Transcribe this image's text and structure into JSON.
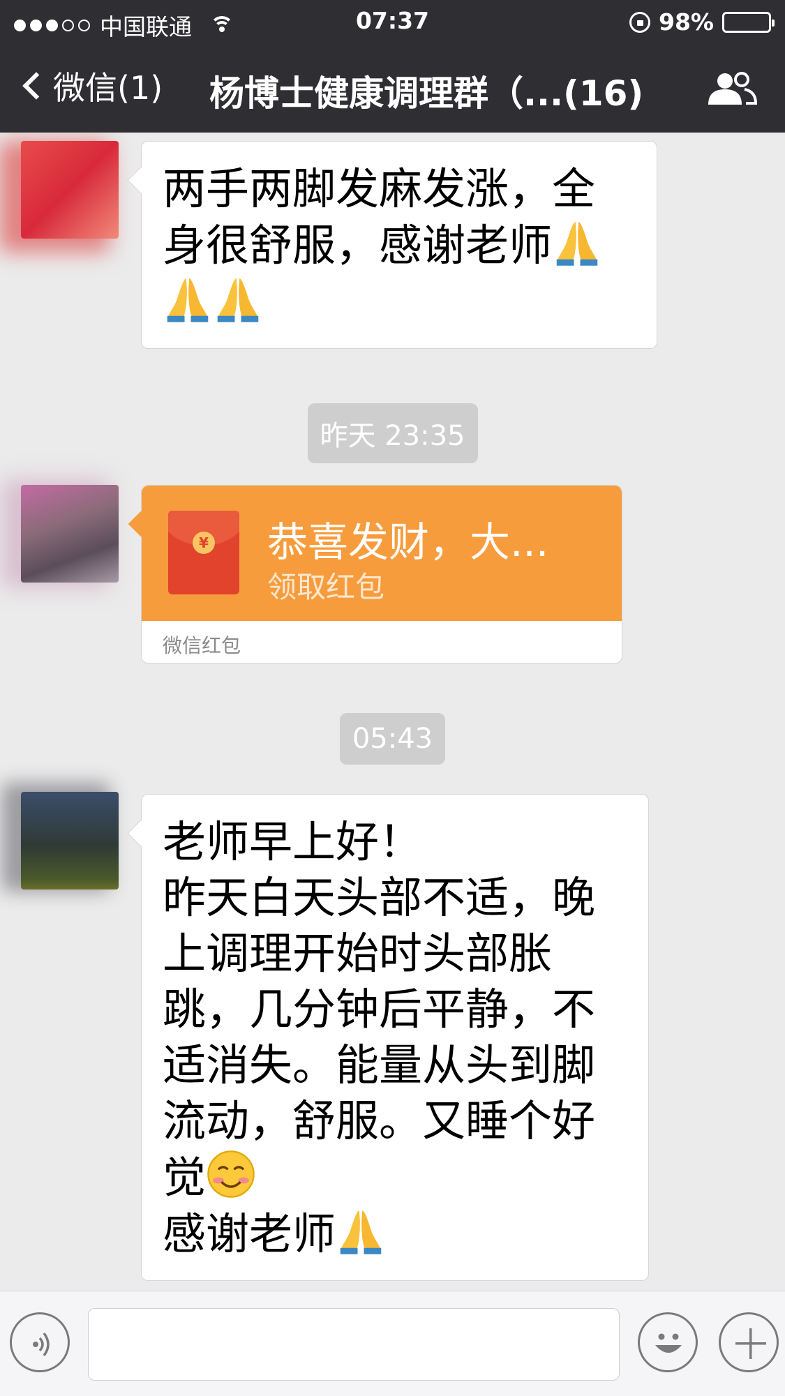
{
  "status_bar": {
    "carrier": "中国联通",
    "time": "07:37",
    "battery": "98%",
    "battery_level": 0.98
  },
  "nav": {
    "back_label": "微信(1)",
    "title": "杨博士健康调理群（...(16)"
  },
  "messages": [
    {
      "type": "text",
      "lines": [
        "两手两脚发麻发涨，全",
        "身很舒服，感谢老师"
      ],
      "emojis": [
        "folded-hands",
        "folded-hands",
        "folded-hands"
      ]
    },
    {
      "type": "timestamp",
      "text": "昨天 23:35"
    },
    {
      "type": "red_packet",
      "title": "恭喜发财，大...",
      "subtitle": "领取红包",
      "footer": "微信红包"
    },
    {
      "type": "timestamp",
      "text": "05:43"
    },
    {
      "type": "text",
      "lines": [
        "老师早上好！",
        "昨天白天头部不适，晚",
        "上调理开始时头部胀",
        "跳，几分钟后平静，不",
        "适消失。能量从头到脚",
        "流动，舒服。又睡个好",
        "觉",
        "感谢老师"
      ],
      "emojis": [
        "smiling-face",
        "folded-hands"
      ]
    }
  ],
  "input_bar": {
    "placeholder": "",
    "icons": [
      "voice-icon",
      "emoji-icon",
      "plus-icon"
    ]
  },
  "colors": {
    "nav_bg": "#2e2e33",
    "chat_bg": "#ebebeb",
    "red_packet": "#f79c3d"
  }
}
